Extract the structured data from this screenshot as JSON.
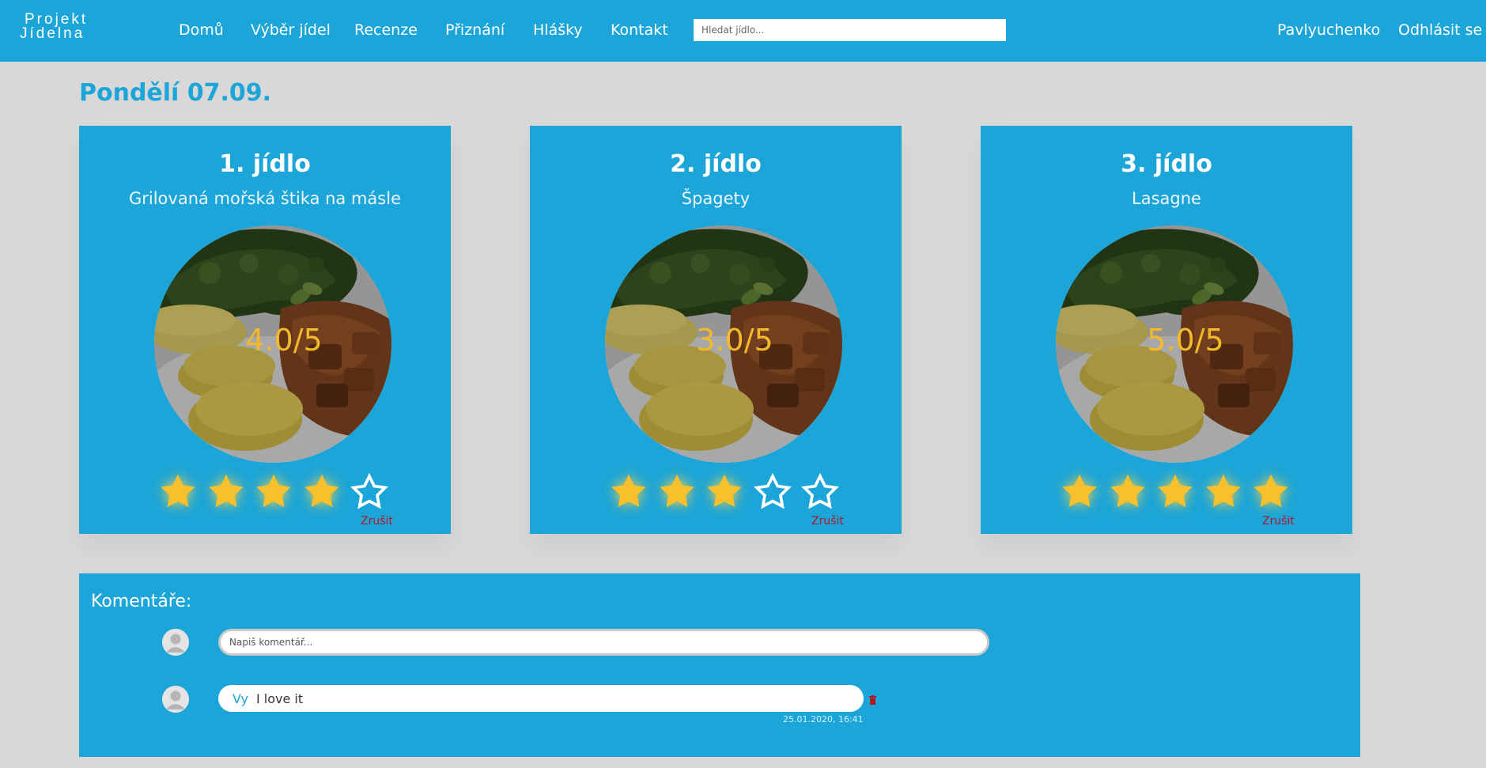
{
  "nav": {
    "logo_line1": "Projekt",
    "logo_line2": "Jídelna",
    "links": [
      "Domů",
      "Výběr jídel",
      "Recenze",
      "Přiznání",
      "Hlášky",
      "Kontakt"
    ],
    "search_placeholder": "Hledat jídlo...",
    "user": "Pavlyuchenko",
    "logout": "Odhlásit se"
  },
  "day": {
    "title": "Pondělí 07.09."
  },
  "meals": [
    {
      "title": "1. jídlo",
      "dish": "Grilovaná mořská štika na másle",
      "rating_text": "4.0/5",
      "rating": 4,
      "max": 5,
      "cancel": "Zrušit"
    },
    {
      "title": "2. jídlo",
      "dish": "Špagety",
      "rating_text": "3.0/5",
      "rating": 3,
      "max": 5,
      "cancel": "Zrušit"
    },
    {
      "title": "3. jídlo",
      "dish": "Lasagne",
      "rating_text": "5.0/5",
      "rating": 5,
      "max": 5,
      "cancel": "Zrušit"
    }
  ],
  "comments": {
    "title": "Komentáře:",
    "input_placeholder": "Napiš komentář...",
    "items": [
      {
        "author": "Vy",
        "text": "I love it",
        "time": "25.01.2020, 16:41"
      }
    ]
  },
  "colors": {
    "primary": "#1ba5d8",
    "background": "#d8d8d8",
    "star": "#f7c02c",
    "cancel": "#b0182a"
  },
  "icons": [
    "user-avatar-icon",
    "star-icon",
    "star-outline-icon",
    "trash-icon"
  ]
}
